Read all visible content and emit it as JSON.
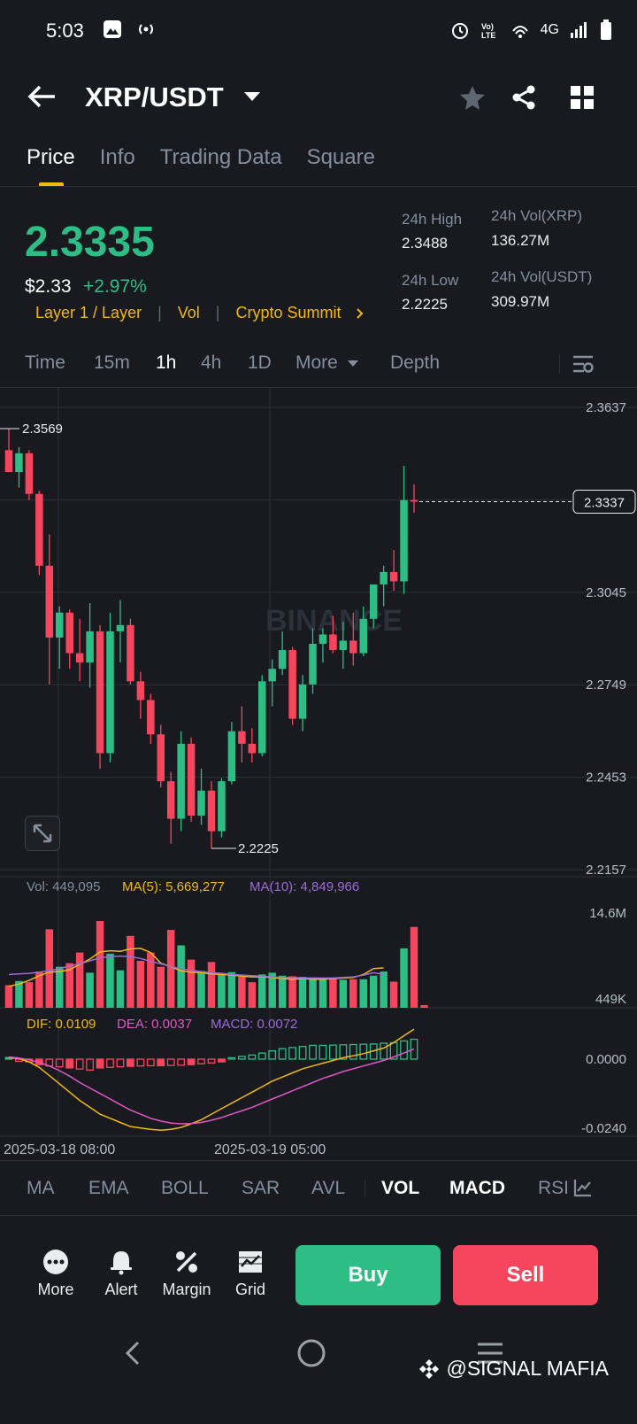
{
  "status_bar": {
    "time": "5:03",
    "network": "4G"
  },
  "header": {
    "pair": "XRP/USDT"
  },
  "tabs": [
    "Price",
    "Info",
    "Trading Data",
    "Square"
  ],
  "price": {
    "last": "2.3335",
    "usd": "$2.33",
    "change": "+2.97%",
    "tags": [
      "Layer 1 / Layer",
      "Vol",
      "Crypto Summit"
    ],
    "stats": {
      "high_label": "24h High",
      "high": "2.3488",
      "low_label": "24h Low",
      "low": "2.2225",
      "vol_base_label": "24h Vol(XRP)",
      "vol_base": "136.27M",
      "vol_quote_label": "24h Vol(USDT)",
      "vol_quote": "309.97M"
    }
  },
  "intervals": [
    "Time",
    "15m",
    "1h",
    "4h",
    "1D",
    "More",
    "Depth"
  ],
  "chart": {
    "y_ticks": [
      "2.3637",
      "2.3341",
      "2.3045",
      "2.2749",
      "2.2453",
      "2.2157"
    ],
    "high_marker": "2.3569",
    "low_marker": "2.2225",
    "current_price": "2.3337",
    "watermark": "BINANCE",
    "vol_legend": {
      "vol": "Vol: 449,095",
      "ma5": "MA(5): 5,669,277",
      "ma10": "MA(10): 4,849,966"
    },
    "vol_axis": [
      "14.6M",
      "449K"
    ],
    "macd_legend": {
      "dif": "DIF: 0.0109",
      "dea": "DEA: 0.0037",
      "macd": "MACD: 0.0072"
    },
    "macd_axis": [
      "0.0000",
      "-0.0240"
    ],
    "x_labels": [
      "2025-03-18 08:00",
      "2025-03-19 05:00"
    ]
  },
  "chart_data": {
    "type": "candlestick",
    "timeframe": "1h",
    "ylim": [
      2.2157,
      2.3637
    ],
    "candles": [
      {
        "o": 2.35,
        "h": 2.3569,
        "l": 2.344,
        "c": 2.343
      },
      {
        "o": 2.343,
        "h": 2.351,
        "l": 2.338,
        "c": 2.349
      },
      {
        "o": 2.349,
        "h": 2.35,
        "l": 2.334,
        "c": 2.336
      },
      {
        "o": 2.336,
        "h": 2.337,
        "l": 2.31,
        "c": 2.313
      },
      {
        "o": 2.313,
        "h": 2.323,
        "l": 2.275,
        "c": 2.29
      },
      {
        "o": 2.29,
        "h": 2.3,
        "l": 2.28,
        "c": 2.298
      },
      {
        "o": 2.298,
        "h": 2.299,
        "l": 2.28,
        "c": 2.285
      },
      {
        "o": 2.285,
        "h": 2.296,
        "l": 2.276,
        "c": 2.282
      },
      {
        "o": 2.282,
        "h": 2.301,
        "l": 2.274,
        "c": 2.292
      },
      {
        "o": 2.292,
        "h": 2.294,
        "l": 2.248,
        "c": 2.253
      },
      {
        "o": 2.253,
        "h": 2.298,
        "l": 2.25,
        "c": 2.292
      },
      {
        "o": 2.292,
        "h": 2.302,
        "l": 2.282,
        "c": 2.294
      },
      {
        "o": 2.294,
        "h": 2.296,
        "l": 2.275,
        "c": 2.276
      },
      {
        "o": 2.276,
        "h": 2.279,
        "l": 2.264,
        "c": 2.27
      },
      {
        "o": 2.27,
        "h": 2.272,
        "l": 2.256,
        "c": 2.259
      },
      {
        "o": 2.259,
        "h": 2.262,
        "l": 2.242,
        "c": 2.244
      },
      {
        "o": 2.244,
        "h": 2.247,
        "l": 2.224,
        "c": 2.232
      },
      {
        "o": 2.232,
        "h": 2.26,
        "l": 2.228,
        "c": 2.256
      },
      {
        "o": 2.256,
        "h": 2.258,
        "l": 2.231,
        "c": 2.233
      },
      {
        "o": 2.233,
        "h": 2.248,
        "l": 2.23,
        "c": 2.241
      },
      {
        "o": 2.241,
        "h": 2.244,
        "l": 2.2225,
        "c": 2.228
      },
      {
        "o": 2.228,
        "h": 2.245,
        "l": 2.226,
        "c": 2.244
      },
      {
        "o": 2.244,
        "h": 2.263,
        "l": 2.243,
        "c": 2.26
      },
      {
        "o": 2.26,
        "h": 2.268,
        "l": 2.25,
        "c": 2.256
      },
      {
        "o": 2.256,
        "h": 2.261,
        "l": 2.25,
        "c": 2.253
      },
      {
        "o": 2.253,
        "h": 2.278,
        "l": 2.252,
        "c": 2.276
      },
      {
        "o": 2.276,
        "h": 2.283,
        "l": 2.268,
        "c": 2.28
      },
      {
        "o": 2.28,
        "h": 2.292,
        "l": 2.278,
        "c": 2.286
      },
      {
        "o": 2.286,
        "h": 2.287,
        "l": 2.262,
        "c": 2.264
      },
      {
        "o": 2.264,
        "h": 2.278,
        "l": 2.26,
        "c": 2.275
      },
      {
        "o": 2.275,
        "h": 2.293,
        "l": 2.272,
        "c": 2.288
      },
      {
        "o": 2.288,
        "h": 2.293,
        "l": 2.282,
        "c": 2.291
      },
      {
        "o": 2.291,
        "h": 2.297,
        "l": 2.285,
        "c": 2.286
      },
      {
        "o": 2.286,
        "h": 2.295,
        "l": 2.28,
        "c": 2.289
      },
      {
        "o": 2.289,
        "h": 2.298,
        "l": 2.281,
        "c": 2.285
      },
      {
        "o": 2.285,
        "h": 2.3,
        "l": 2.284,
        "c": 2.296
      },
      {
        "o": 2.296,
        "h": 2.307,
        "l": 2.293,
        "c": 2.307
      },
      {
        "o": 2.307,
        "h": 2.313,
        "l": 2.3,
        "c": 2.311
      },
      {
        "o": 2.311,
        "h": 2.318,
        "l": 2.305,
        "c": 2.308
      },
      {
        "o": 2.308,
        "h": 2.345,
        "l": 2.304,
        "c": 2.334
      },
      {
        "o": 2.334,
        "h": 2.339,
        "l": 2.33,
        "c": 2.3335
      }
    ],
    "volume": {
      "ylim": [
        0,
        14.6
      ],
      "unit": "M",
      "values": [
        3.8,
        4.5,
        4.3,
        6.1,
        13.2,
        6.9,
        7.5,
        9.3,
        5.9,
        14.6,
        9.1,
        6.3,
        12.1,
        7.9,
        9.3,
        6.9,
        13.1,
        10.5,
        8.1,
        6.2,
        7.7,
        5.7,
        6.0,
        5.2,
        4.3,
        5.6,
        5.9,
        5.4,
        5.3,
        5.2,
        5.1,
        4.8,
        5.0,
        4.7,
        4.8,
        4.8,
        5.4,
        6.1,
        4.4,
        10.0,
        13.6,
        0.45
      ],
      "ma5": [
        3.6,
        4.0,
        4.6,
        5.4,
        6.0,
        6.1,
        6.4,
        7.3,
        8.2,
        9.4,
        9.6,
        9.5,
        9.9,
        10.0,
        9.3,
        7.5,
        6.9,
        6.2,
        6.0,
        5.9,
        5.7,
        5.6,
        5.5,
        5.3,
        5.2,
        5.2,
        5.1,
        4.9,
        4.8,
        4.9,
        4.8,
        4.8,
        4.9,
        5.0,
        5.1,
        5.6,
        6.6,
        6.7
      ],
      "ma10": [
        5.6,
        5.7,
        5.8,
        6.0,
        6.2,
        6.6,
        7.0,
        7.4,
        7.9,
        8.4,
        8.6,
        8.7,
        8.6,
        8.3,
        7.8,
        7.4,
        6.9,
        6.6,
        6.3,
        6.1,
        5.9,
        5.8,
        5.6,
        5.5,
        5.4,
        5.3,
        5.2,
        5.1,
        5.1,
        5.0,
        5.0,
        5.0,
        5.0,
        5.1,
        5.2,
        5.5,
        5.9,
        5.6
      ]
    },
    "macd": {
      "ylim": [
        -0.028,
        0.009
      ],
      "hist": [
        0.0006,
        -0.0008,
        -0.001,
        -0.002,
        -0.0025,
        -0.0028,
        -0.0032,
        -0.0036,
        -0.004,
        -0.0032,
        -0.003,
        -0.0028,
        -0.0026,
        -0.0025,
        -0.0024,
        -0.0024,
        -0.0023,
        -0.0022,
        -0.002,
        -0.0017,
        -0.0014,
        -0.001,
        0.0005,
        0.001,
        0.0015,
        0.0022,
        0.003,
        0.0038,
        0.0042,
        0.0046,
        0.005,
        0.005,
        0.0051,
        0.0052,
        0.0053,
        0.0054,
        0.0055,
        0.0058,
        0.006,
        0.0066,
        0.0072
      ],
      "dif": [
        0.0005,
        0.0002,
        -0.001,
        -0.003,
        -0.006,
        -0.009,
        -0.012,
        -0.015,
        -0.0175,
        -0.02,
        -0.0215,
        -0.023,
        -0.0245,
        -0.025,
        -0.0255,
        -0.0258,
        -0.0255,
        -0.0248,
        -0.0235,
        -0.022,
        -0.02,
        -0.018,
        -0.016,
        -0.014,
        -0.012,
        -0.01,
        -0.008,
        -0.0065,
        -0.005,
        -0.0035,
        -0.0025,
        -0.0015,
        -0.0005,
        0.0005,
        0.0012,
        0.002,
        0.003,
        0.004,
        0.006,
        0.0085,
        0.0109
      ],
      "dea": [
        0.0008,
        0.0004,
        -0.0003,
        -0.0012,
        -0.0025,
        -0.0042,
        -0.0062,
        -0.0085,
        -0.0105,
        -0.0125,
        -0.0145,
        -0.0165,
        -0.0185,
        -0.02,
        -0.0215,
        -0.0225,
        -0.0232,
        -0.0235,
        -0.0234,
        -0.023,
        -0.0222,
        -0.0212,
        -0.02,
        -0.0188,
        -0.0175,
        -0.016,
        -0.0145,
        -0.013,
        -0.0115,
        -0.01,
        -0.0085,
        -0.007,
        -0.0058,
        -0.0045,
        -0.0035,
        -0.0025,
        -0.0015,
        -0.0005,
        0.0008,
        0.0022,
        0.0037
      ]
    }
  },
  "indicators": [
    "MA",
    "EMA",
    "BOLL",
    "SAR",
    "AVL",
    "VOL",
    "MACD",
    "RSI"
  ],
  "indicators_active": [
    "VOL",
    "MACD"
  ],
  "actions": [
    "More",
    "Alert",
    "Margin",
    "Grid"
  ],
  "buy_label": "Buy",
  "sell_label": "Sell",
  "watermark_handle": "@SIGNAL MAFIA",
  "colors": {
    "up": "#2ebd85",
    "down": "#f6465d",
    "accent": "#f0b90b",
    "bg": "#181a20"
  }
}
